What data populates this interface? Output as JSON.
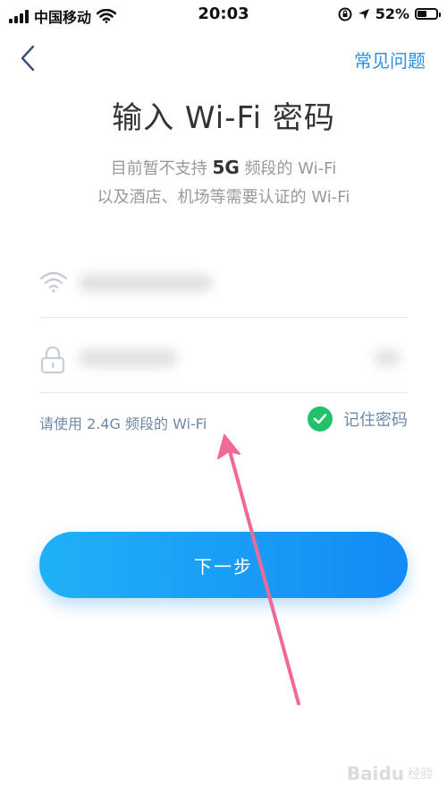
{
  "status_bar": {
    "carrier": "中国移动",
    "time": "20:03",
    "battery_pct": "52%",
    "battery_level": 0.52
  },
  "nav": {
    "faq_label": "常见问题"
  },
  "title": "输入 Wi-Fi 密码",
  "notice": {
    "line1_prefix": "目前暂不支持",
    "line1_highlight": "5G",
    "line1_suffix": "频段的 Wi-Fi",
    "line2": "以及酒店、机场等需要认证的 Wi-Fi"
  },
  "form": {
    "hint": "请使用 2.4G 频段的 Wi-Fi",
    "remember_label": "记住密码",
    "remember_checked": true,
    "next_label": "下一步"
  },
  "icons": {
    "wifi": "wifi-icon",
    "lock": "lock-icon",
    "check": "check-icon",
    "back": "chevron-left-icon"
  },
  "colors": {
    "accent": "#2a8fe6",
    "check_green": "#20c26a",
    "button_start": "#1fb1f6",
    "button_end": "#138bf5",
    "annotation": "#f06a95"
  },
  "watermark": {
    "text": "Baidu",
    "sub": "经验"
  }
}
